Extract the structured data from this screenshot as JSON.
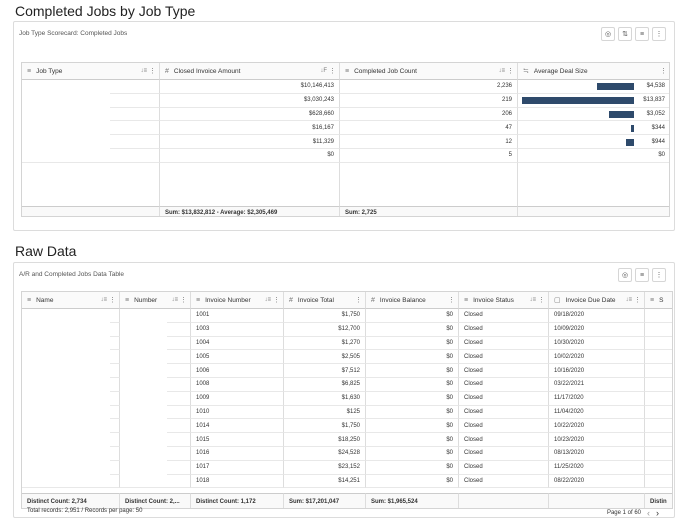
{
  "section1": {
    "title": "Completed Jobs by Job Type",
    "subtitle": "Job Type Scorecard: Completed Jobs",
    "columns": [
      {
        "label": "Job Type",
        "icon": "≡"
      },
      {
        "label": "Closed Invoice Amount",
        "icon": "#"
      },
      {
        "label": "Completed Job Count",
        "icon": "≡"
      },
      {
        "label": "Average Deal Size",
        "icon": "≒"
      }
    ],
    "rows": [
      {
        "amount": "$10,146,413",
        "count": "2,236",
        "avg": "$4,538",
        "avg_value": 4538
      },
      {
        "amount": "$3,030,243",
        "count": "219",
        "avg": "$13,837",
        "avg_value": 13837
      },
      {
        "amount": "$628,660",
        "count": "206",
        "avg": "$3,052",
        "avg_value": 3052
      },
      {
        "amount": "$16,167",
        "count": "47",
        "avg": "$344",
        "avg_value": 344
      },
      {
        "amount": "$11,329",
        "count": "12",
        "avg": "$944",
        "avg_value": 944
      },
      {
        "amount": "$0",
        "count": "5",
        "avg": "$0",
        "avg_value": 0
      }
    ],
    "footer_amount": "Sum: $13,832,812 - Average: $2,305,469",
    "footer_count": "Sum: 2,725"
  },
  "section2": {
    "title": "Raw Data",
    "subtitle": "A/R and Completed Jobs Data Table",
    "columns": [
      {
        "label": "Name",
        "icon": "≡"
      },
      {
        "label": "Number",
        "icon": "≡"
      },
      {
        "label": "Invoice Number",
        "icon": "≡"
      },
      {
        "label": "Invoice Total",
        "icon": "#"
      },
      {
        "label": "Invoice Balance",
        "icon": "#"
      },
      {
        "label": "Invoice Status",
        "icon": "≡"
      },
      {
        "label": "Invoice Due Date",
        "icon": "▢"
      },
      {
        "label": "S",
        "icon": "≡"
      }
    ],
    "rows": [
      {
        "inv": "1001",
        "total": "$1,750",
        "balance": "$0",
        "status": "Closed",
        "due": "09/18/2020"
      },
      {
        "inv": "1003",
        "total": "$12,700",
        "balance": "$0",
        "status": "Closed",
        "due": "10/09/2020"
      },
      {
        "inv": "1004",
        "total": "$1,270",
        "balance": "$0",
        "status": "Closed",
        "due": "10/30/2020"
      },
      {
        "inv": "1005",
        "total": "$2,505",
        "balance": "$0",
        "status": "Closed",
        "due": "10/02/2020"
      },
      {
        "inv": "1006",
        "total": "$7,512",
        "balance": "$0",
        "status": "Closed",
        "due": "10/16/2020"
      },
      {
        "inv": "1008",
        "total": "$6,825",
        "balance": "$0",
        "status": "Closed",
        "due": "03/22/2021"
      },
      {
        "inv": "1009",
        "total": "$1,630",
        "balance": "$0",
        "status": "Closed",
        "due": "11/17/2020"
      },
      {
        "inv": "1010",
        "total": "$125",
        "balance": "$0",
        "status": "Closed",
        "due": "11/04/2020"
      },
      {
        "inv": "1014",
        "total": "$1,750",
        "balance": "$0",
        "status": "Closed",
        "due": "10/22/2020"
      },
      {
        "inv": "1015",
        "total": "$18,250",
        "balance": "$0",
        "status": "Closed",
        "due": "10/23/2020"
      },
      {
        "inv": "1016",
        "total": "$24,528",
        "balance": "$0",
        "status": "Closed",
        "due": "08/13/2020"
      },
      {
        "inv": "1017",
        "total": "$23,152",
        "balance": "$0",
        "status": "Closed",
        "due": "11/25/2020"
      },
      {
        "inv": "1018",
        "total": "$14,251",
        "balance": "$0",
        "status": "Closed",
        "due": "08/22/2020"
      }
    ],
    "footer": {
      "name": "Distinct Count: 2,734",
      "number": "Distinct Count: 2,...",
      "inv": "Distinct Count: 1,172",
      "total": "Sum: $17,201,047",
      "balance": "Sum: $1,965,524",
      "extra": "Distin"
    },
    "pager": {
      "total_label": "Total records:",
      "total_value": "2,951",
      "separator": "/",
      "per_page_label": "Records per page:",
      "per_page_value": "50",
      "page_text": "Page 1 of 60"
    }
  },
  "icons": {
    "hide": "eye-off-icon",
    "sort": "sort-icon",
    "filter": "filter-icon",
    "more": "more-vertical-icon"
  },
  "colors": {
    "bar": "#2e4a6b"
  }
}
